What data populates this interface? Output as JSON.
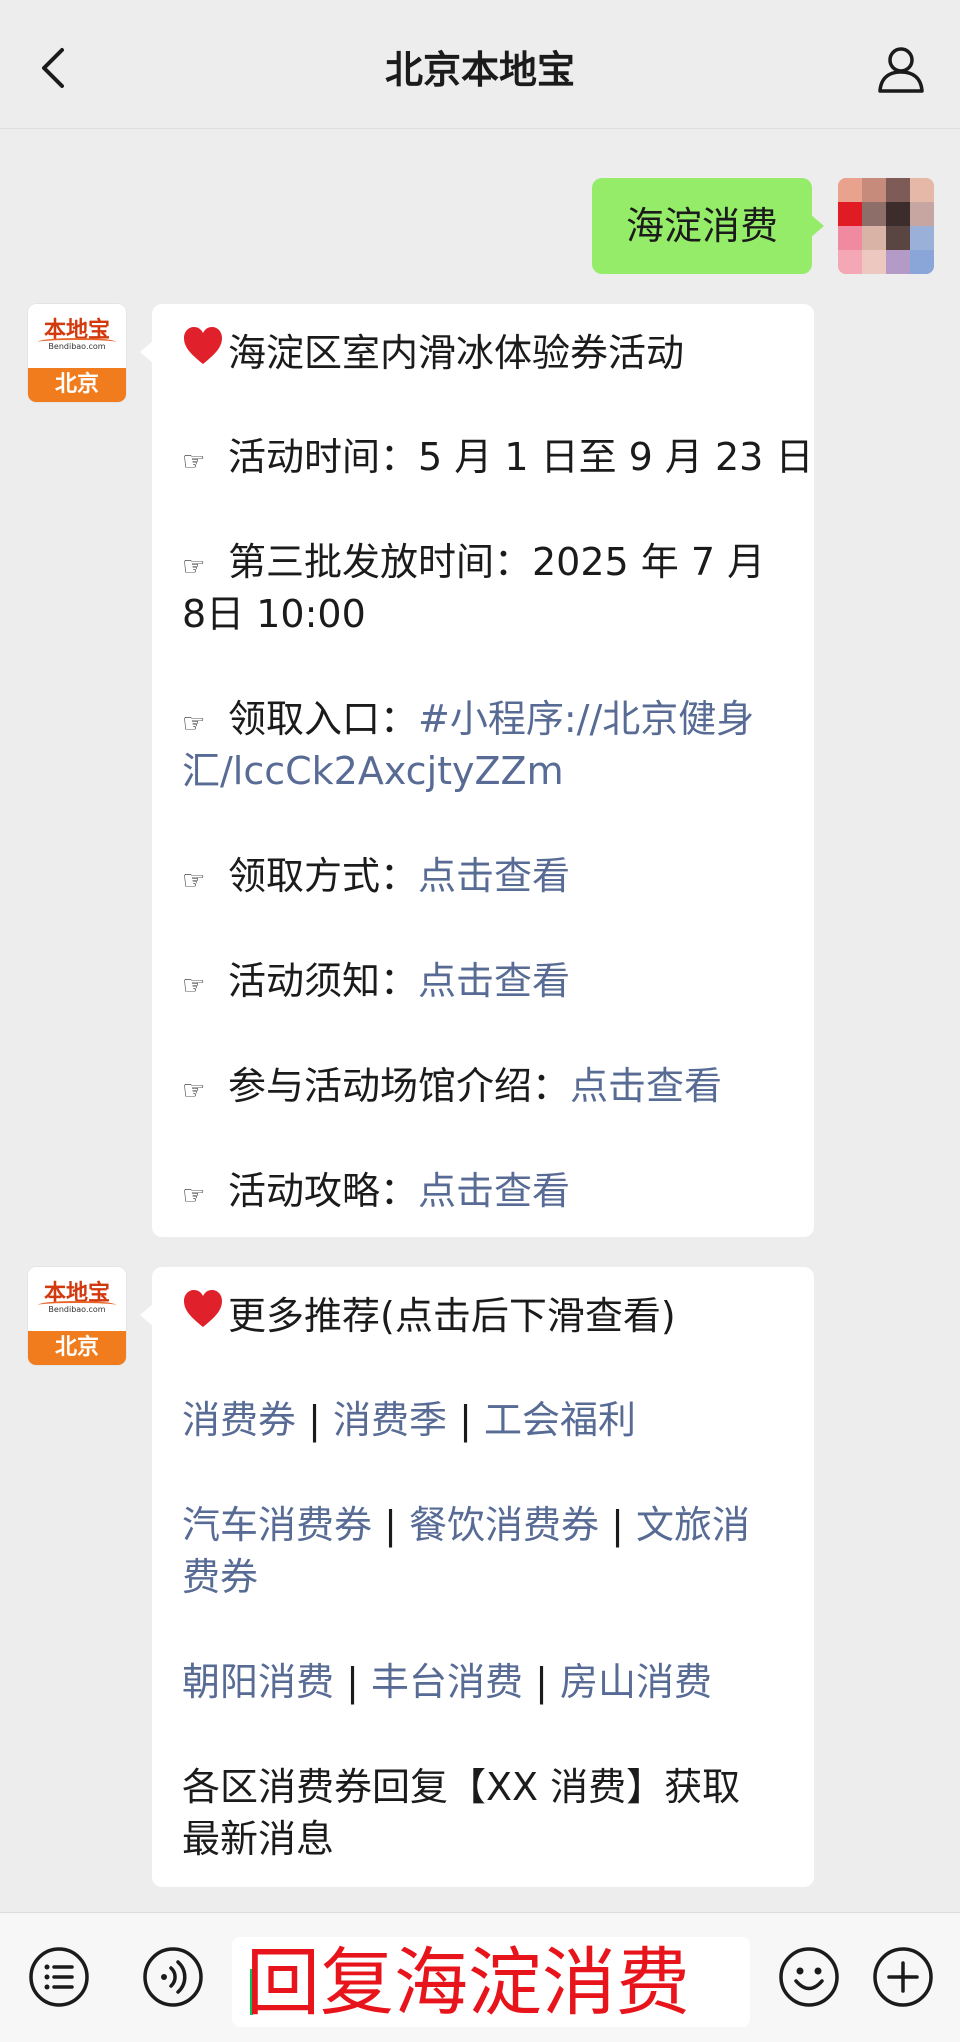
{
  "header": {
    "title": "北京本地宝"
  },
  "outgoing": {
    "text": "海淀消费"
  },
  "avatar": {
    "logo_text": "本地宝",
    "url_text": "Bendibao.com",
    "city": "北京"
  },
  "msg1": {
    "title": "海淀区室内滑冰体验券活动",
    "lines": [
      {
        "label": "活动时间：5 月 1 日至 9 月 23 日"
      },
      {
        "label": "第三批发放时间：2025 年 7 月",
        "cont": "8日 10:00"
      },
      {
        "label": "领取入口：",
        "link": "#小程序://北京健身",
        "link_cont": "汇/lccCk2AxcjtyZZm"
      },
      {
        "label": "领取方式：",
        "link": "点击查看"
      },
      {
        "label": "活动须知：",
        "link": "点击查看"
      },
      {
        "label": "参与活动场馆介绍：",
        "link": "点击查看"
      },
      {
        "label": "活动攻略：",
        "link": "点击查看"
      }
    ]
  },
  "msg2": {
    "title": "更多推荐(点击后下滑查看)",
    "row1": [
      "消费券",
      "消费季",
      "工会福利"
    ],
    "row2": [
      "汽车消费券",
      "餐饮消费券",
      "文旅消"
    ],
    "row2_cont": "费券",
    "row3": [
      "朝阳消费",
      "丰台消费",
      "房山消费"
    ],
    "note": "各区消费券回复【XX 消费】获取",
    "note_cont": "最新消息",
    "separator": "|"
  },
  "input": {
    "value": "回复海淀消费"
  }
}
